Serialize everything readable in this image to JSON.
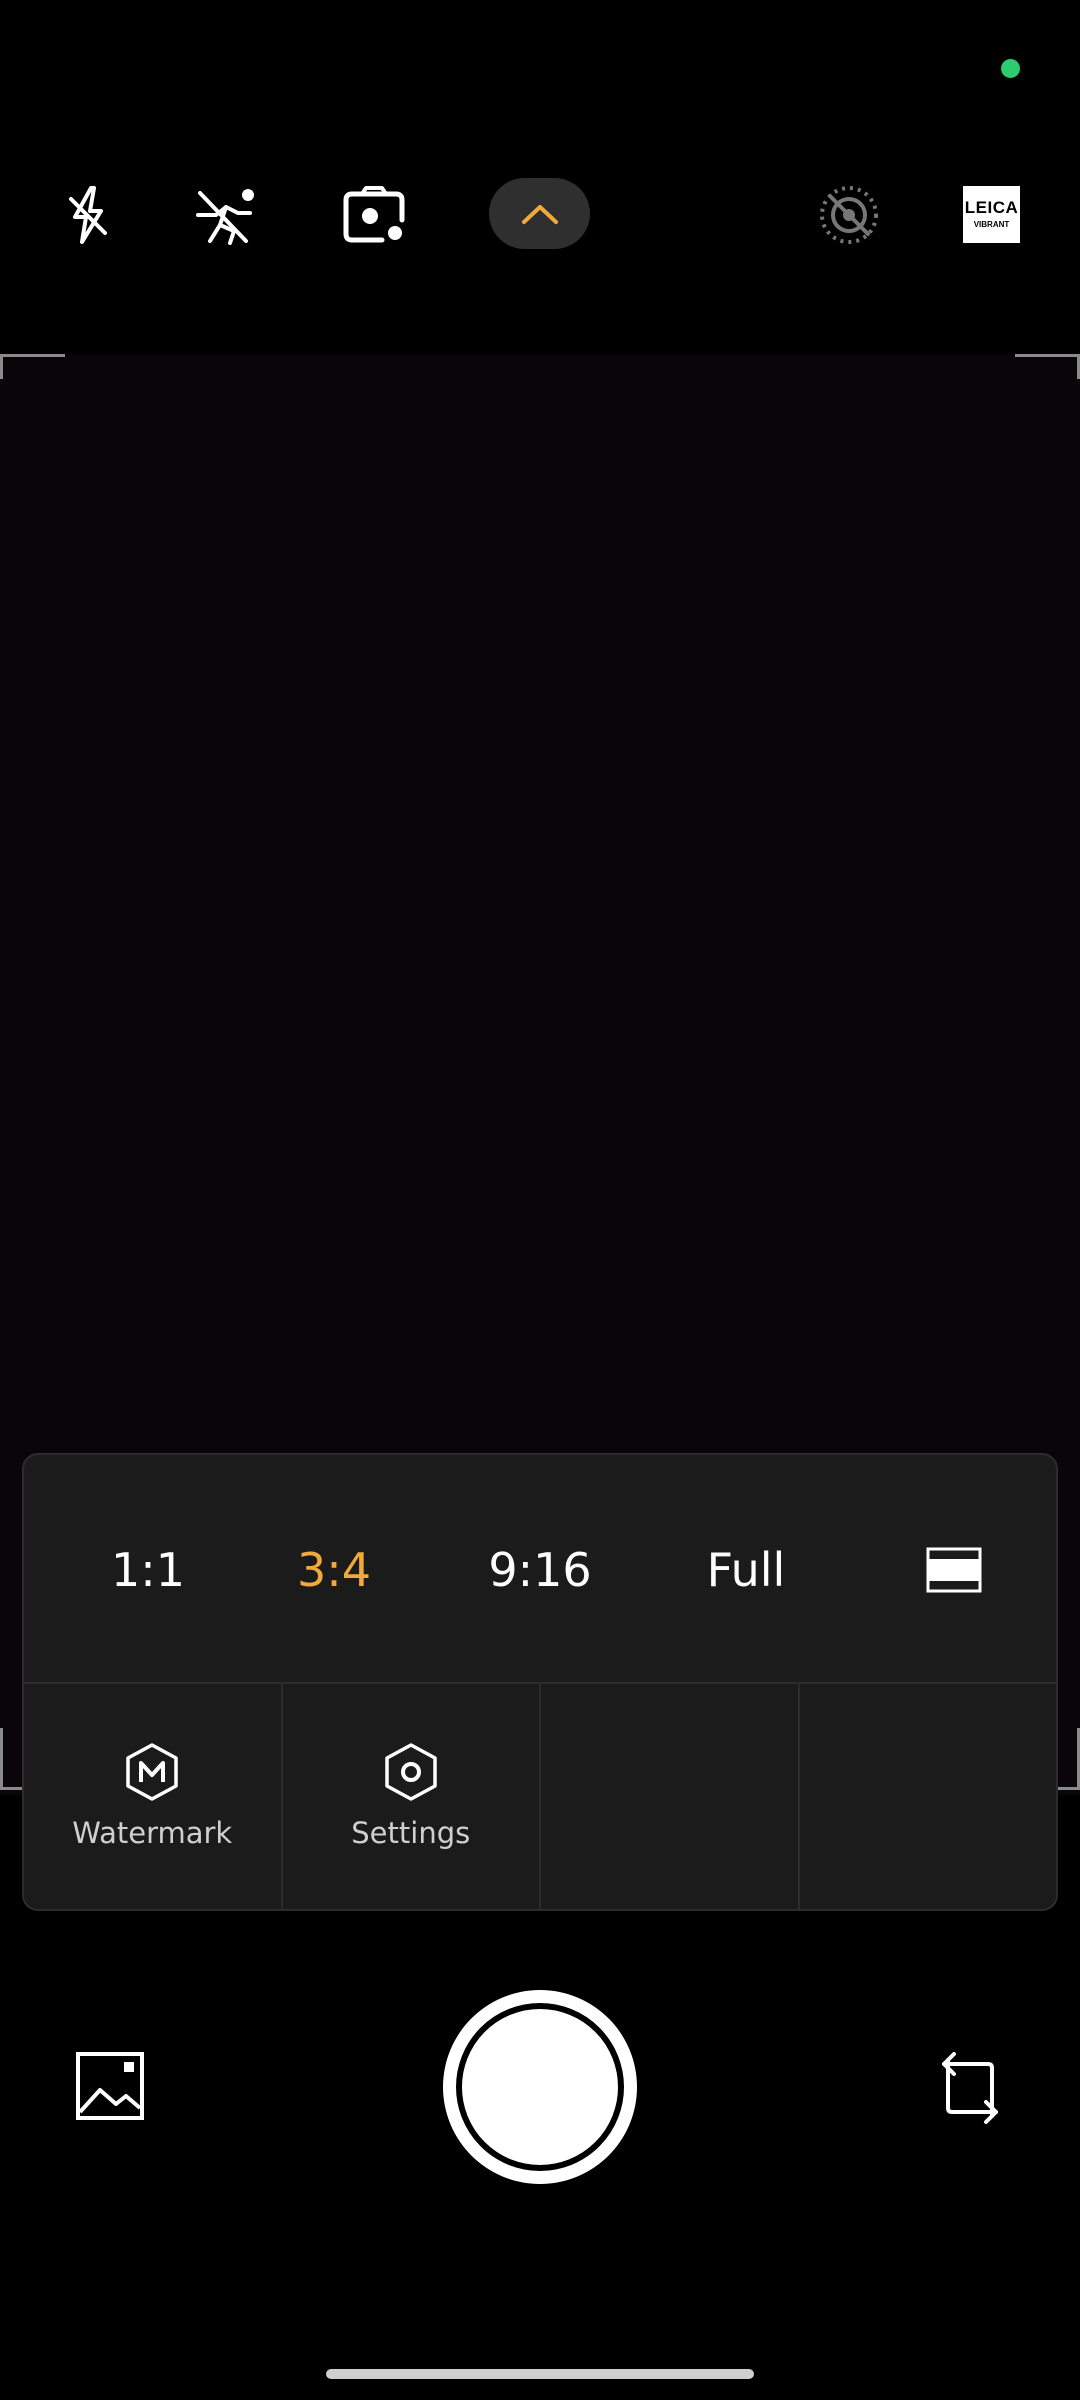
{
  "colors": {
    "accent": "#f2a93b",
    "status_dot": "#2ecc71",
    "text": "#ffffff",
    "panel_bg": "#1b1b1b"
  },
  "top_bar": {
    "icons": [
      "flash-off-icon",
      "motion-capture-off-icon",
      "camera-lens-icon",
      "chevron-up-icon",
      "live-photo-off-icon"
    ],
    "leica_badge": {
      "line1": "LEICA",
      "line2": "VIBRANT"
    }
  },
  "aspect_ratios": {
    "options": [
      "1:1",
      "3:4",
      "9:16",
      "Full"
    ],
    "selected": "3:4",
    "extra_icon": "letterbox-icon"
  },
  "tiles": [
    {
      "label": "Watermark",
      "icon": "watermark-hexagon-icon"
    },
    {
      "label": "Settings",
      "icon": "settings-hexagon-icon"
    },
    {
      "label": "",
      "icon": ""
    },
    {
      "label": "",
      "icon": ""
    }
  ],
  "bottom_controls": {
    "gallery_icon": "gallery-icon",
    "shutter_icon": "shutter-button",
    "flip_icon": "flip-camera-icon"
  }
}
